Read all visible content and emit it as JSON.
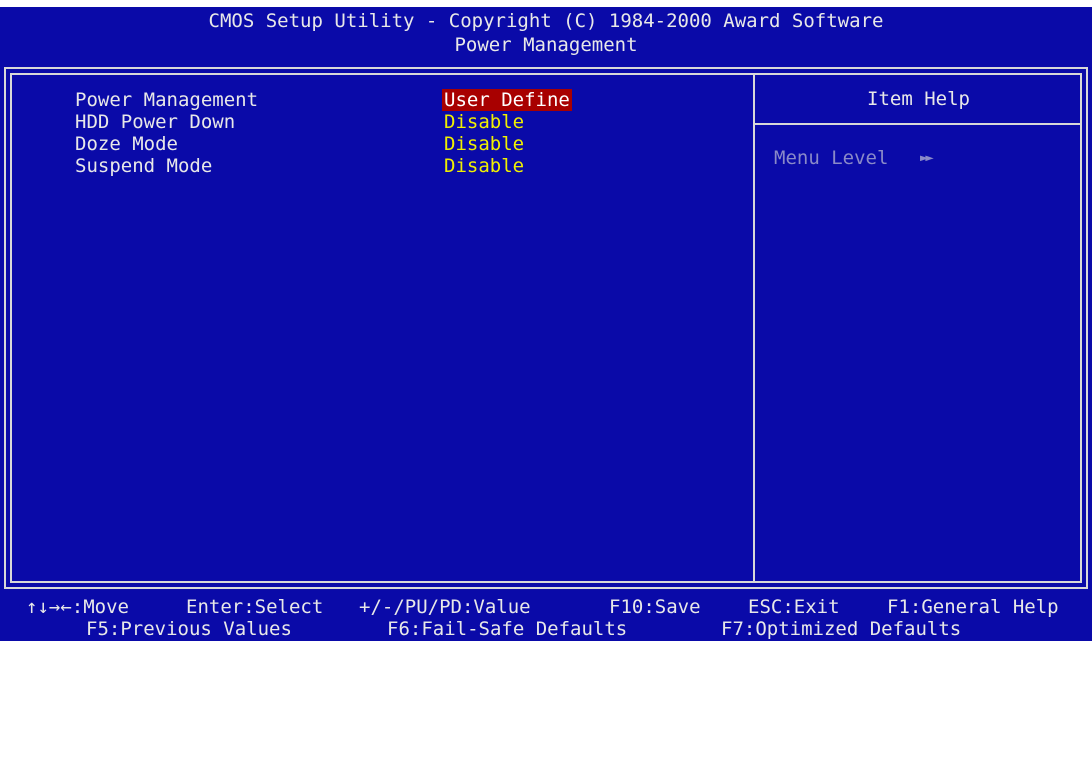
{
  "header": {
    "title": "CMOS Setup Utility - Copyright (C) 1984-2000 Award Software",
    "subtitle": "Power Management"
  },
  "settings": [
    {
      "label": "Power Management",
      "value": "User Define",
      "selected": true
    },
    {
      "label": "HDD Power Down",
      "value": "Disable",
      "selected": false
    },
    {
      "label": "Doze Mode",
      "value": "Disable",
      "selected": false
    },
    {
      "label": "Suspend Mode",
      "value": "Disable",
      "selected": false
    }
  ],
  "help_panel": {
    "title": "Item Help",
    "menu_level_label": "Menu Level",
    "menu_level_icon": "double-right-arrow-icon",
    "menu_level_glyph": "►►"
  },
  "footer": {
    "line1": [
      "↑↓→←:Move",
      "Enter:Select",
      "+/-/PU/PD:Value",
      "F10:Save",
      "ESC:Exit",
      "F1:General Help"
    ],
    "line2": [
      "F5:Previous Values",
      "F6:Fail-Safe Defaults",
      "F7:Optimized Defaults"
    ]
  },
  "colors": {
    "background": "#0a0aa8",
    "text": "#e8e8e8",
    "value": "#f0f000",
    "highlight": "#a80000",
    "dim": "#8a8ac8"
  }
}
